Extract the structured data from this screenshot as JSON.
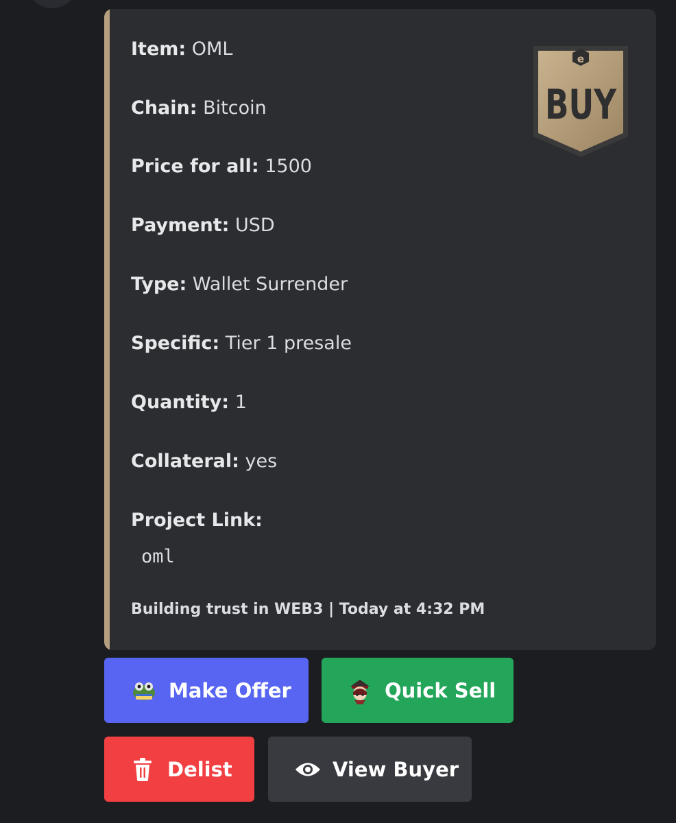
{
  "embed": {
    "accent_color": "#b69f81",
    "thumbnail": {
      "icon": "buy-badge-icon",
      "label": "BUY",
      "logo_letter": "e"
    },
    "fields": [
      {
        "name": "Item:",
        "value": "OML"
      },
      {
        "name": "Chain:",
        "value": "Bitcoin"
      },
      {
        "name": "Price for all:",
        "value": "1500"
      },
      {
        "name": "Payment:",
        "value": "USD"
      },
      {
        "name": "Type:",
        "value": "Wallet Surrender"
      },
      {
        "name": "Specific:",
        "value": "Tier 1 presale"
      },
      {
        "name": "Quantity:",
        "value": "1"
      },
      {
        "name": "Collateral:",
        "value": "yes"
      },
      {
        "name": "Project Link:",
        "value": "oml"
      }
    ],
    "footer": "Building trust in WEB3 | Today at 4:32 PM"
  },
  "buttons": {
    "make_offer": {
      "label": "Make Offer",
      "icon": "frog-emoji-icon",
      "color": "#5865f2"
    },
    "quick_sell": {
      "label": "Quick Sell",
      "icon": "pirate-emoji-icon",
      "color": "#23a55a"
    },
    "delist": {
      "label": "Delist",
      "icon": "trash-icon",
      "color": "#f23f42"
    },
    "view_buyer": {
      "label": "View Buyer",
      "icon": "eye-icon",
      "color": "#383a40"
    }
  }
}
